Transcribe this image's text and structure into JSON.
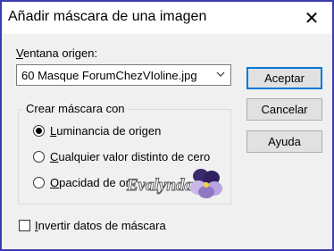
{
  "window": {
    "title": "Añadir máscara de una imagen",
    "close_glyph": "✕"
  },
  "source": {
    "label_accel": "V",
    "label_rest": "entana origen:",
    "selected": "60 Masque ForumChezVIoline.jpg"
  },
  "buttons": {
    "accept": "Aceptar",
    "cancel": "Cancelar",
    "help": "Ayuda"
  },
  "group": {
    "title": "Crear máscara con",
    "options": [
      {
        "accel": "L",
        "rest": "uminancia de origen",
        "checked": true
      },
      {
        "accel": "C",
        "rest": "ualquier valor distinto de cero",
        "checked": false
      },
      {
        "accel": "O",
        "rest": "pacidad de or",
        "checked": false
      }
    ]
  },
  "invert": {
    "accel": "I",
    "rest": "nvertir datos de máscara",
    "checked": false
  },
  "watermark": {
    "text": "Evalynda"
  }
}
